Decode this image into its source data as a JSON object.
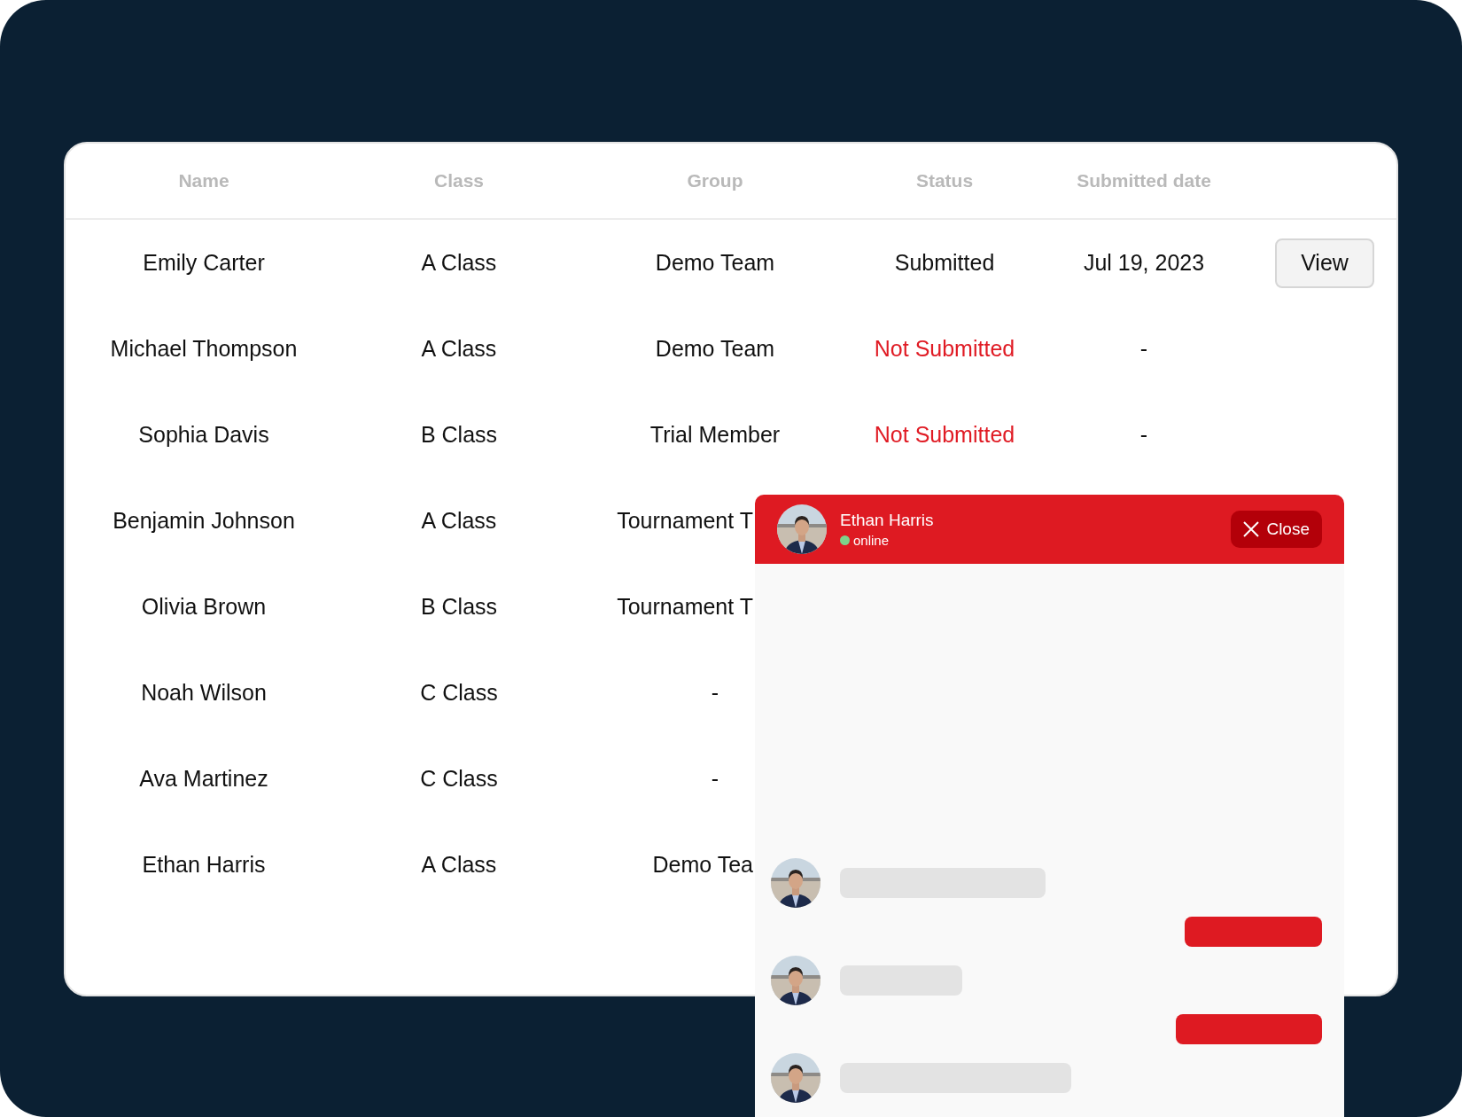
{
  "table": {
    "columns": [
      "Name",
      "Class",
      "Group",
      "Status",
      "Submitted date"
    ],
    "rows": [
      {
        "name": "Emily Carter",
        "class": "A Class",
        "group": "Demo Team",
        "status": "Submitted",
        "submitted": true,
        "date": "Jul 19, 2023",
        "action": "View"
      },
      {
        "name": "Michael Thompson",
        "class": "A Class",
        "group": "Demo Team",
        "status": "Not Submitted",
        "submitted": false,
        "date": "-"
      },
      {
        "name": "Sophia Davis",
        "class": "B Class",
        "group": "Trial Member",
        "status": "Not Submitted",
        "submitted": false,
        "date": "-"
      },
      {
        "name": "Benjamin Johnson",
        "class": "A Class",
        "group": "Tournament T",
        "group_clipped": true
      },
      {
        "name": "Olivia Brown",
        "class": "B Class",
        "group": "Tournament T",
        "group_clipped": true
      },
      {
        "name": "Noah Wilson",
        "class": "C Class",
        "group": "-",
        "group_clipped": false
      },
      {
        "name": "Ava Martinez",
        "class": "C Class",
        "group": "-",
        "group_clipped": false
      },
      {
        "name": "Ethan Harris",
        "class": "A Class",
        "group": "Demo Tea",
        "group_clipped": true
      }
    ]
  },
  "chat": {
    "contact": {
      "name": "Ethan Harris",
      "presence": "online",
      "online": true
    },
    "close_label": "Close",
    "messages": [
      {
        "kind": "incoming"
      },
      {
        "kind": "outgoing"
      },
      {
        "kind": "incoming"
      },
      {
        "kind": "outgoing"
      },
      {
        "kind": "incoming"
      }
    ]
  }
}
